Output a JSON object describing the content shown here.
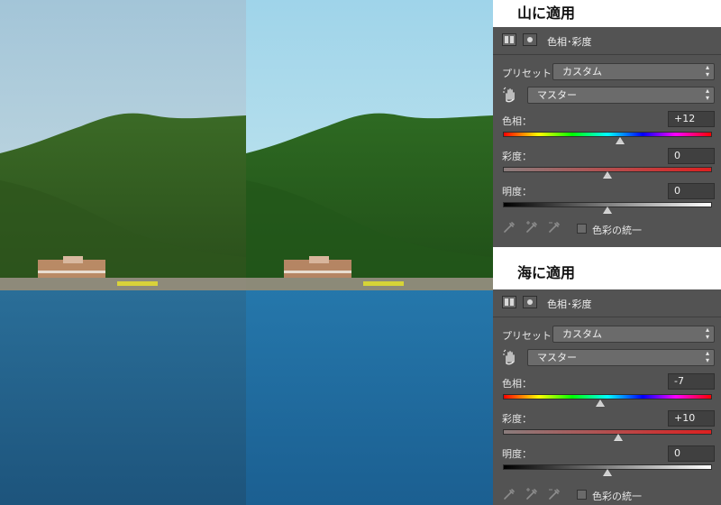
{
  "panels": [
    {
      "caption": "山に適用",
      "title": "色相･彩度",
      "preset_label": "プリセット：",
      "preset_value": "カスタム",
      "channel_value": "マスター",
      "hue_label": "色相：",
      "hue_value": "+12",
      "hue_fraction": 0.56,
      "saturation_label": "彩度：",
      "saturation_value": "0",
      "saturation_fraction": 0.5,
      "lightness_label": "明度：",
      "lightness_value": "0",
      "lightness_fraction": 0.5,
      "colorize_label": "色彩の統一",
      "colorize_checked": false
    },
    {
      "caption": "海に適用",
      "title": "色相･彩度",
      "preset_label": "プリセット：",
      "preset_value": "カスタム",
      "channel_value": "マスター",
      "hue_label": "色相：",
      "hue_value": "-7",
      "hue_fraction": 0.465,
      "saturation_label": "彩度：",
      "saturation_value": "+10",
      "saturation_fraction": 0.55,
      "lightness_label": "明度：",
      "lightness_value": "0",
      "lightness_fraction": 0.5,
      "colorize_label": "色彩の統一",
      "colorize_checked": false
    }
  ],
  "icons": {
    "adjustment": "adjustment-layer-icon",
    "mask": "mask-icon",
    "target": "targeted-adjustment-hand-icon",
    "eyedropper": "eyedropper-icon",
    "eyedropper_plus": "eyedropper-add-icon",
    "eyedropper_minus": "eyedropper-subtract-icon",
    "select_arrows": "updown-arrows-icon"
  },
  "colors": {
    "panel_bg": "#535353",
    "sky_before": "#a9c8d8",
    "sky_after": "#a8d8ea",
    "sea_before": "#1f5f8e",
    "sea_after": "#1f6aa0",
    "forest_before": "#2f5a1f",
    "forest_after": "#255a1c"
  }
}
